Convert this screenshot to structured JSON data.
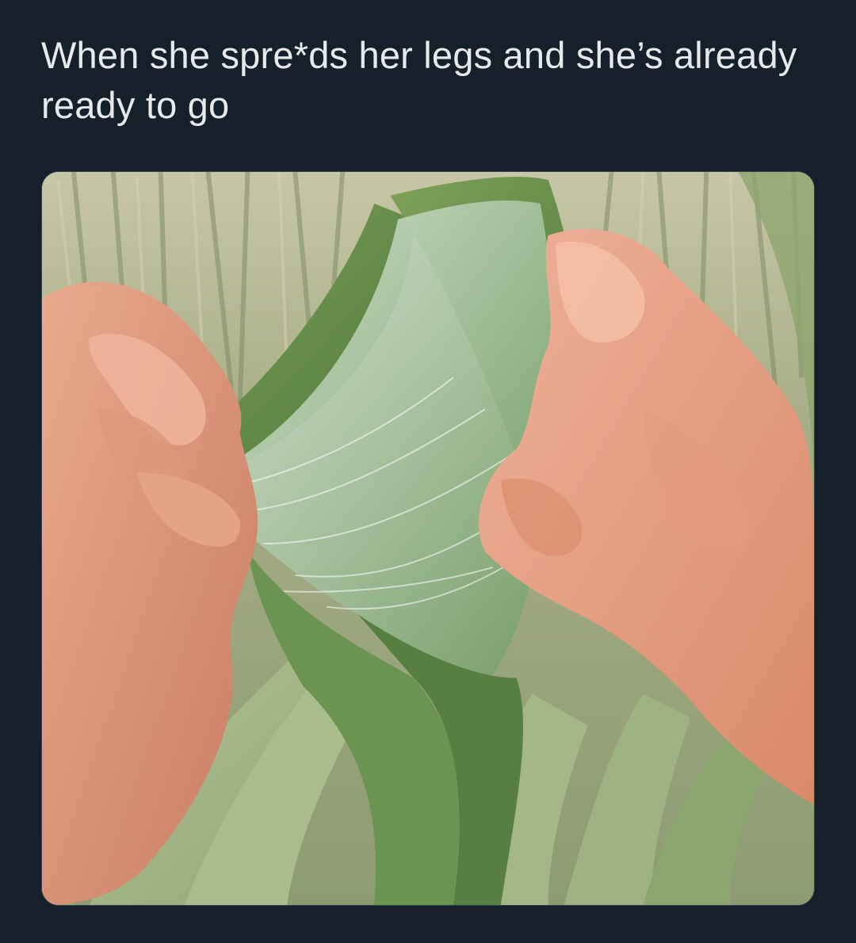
{
  "tweet": {
    "text": "When she spre*ds her legs and she’s already ready to go"
  },
  "media": {
    "type": "photo"
  },
  "colors": {
    "background": "#15202b",
    "text": "#e7e9ea",
    "media_border": "#38444d"
  }
}
